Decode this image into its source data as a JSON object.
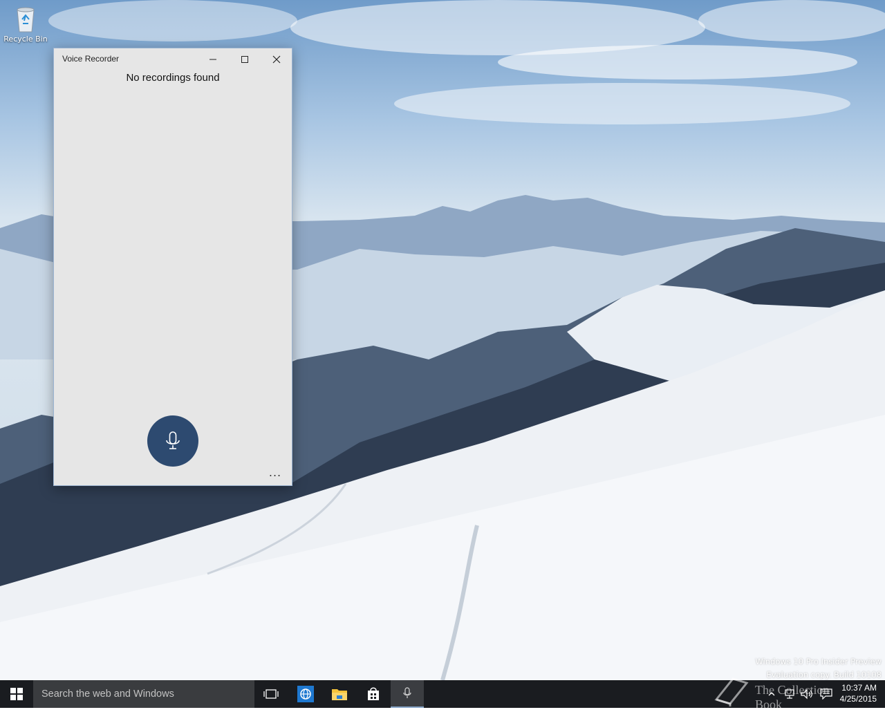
{
  "desktop": {
    "icons": [
      {
        "label": "Recycle Bin",
        "icon": "recycle-bin-icon"
      }
    ],
    "watermark": {
      "line1": "Windows 10 Pro Insider Preview",
      "line2": "Evaluation copy. Build 10108"
    }
  },
  "window": {
    "title": "Voice Recorder",
    "empty_message": "No recordings found",
    "record_icon": "microphone-icon",
    "more_label": "..."
  },
  "taskbar": {
    "search_placeholder": "Search the web and Windows",
    "items": [
      "task-view-icon",
      "edge-icon",
      "file-explorer-icon",
      "store-icon",
      "voice-recorder-icon"
    ],
    "tray_icons": [
      "chevron-up-icon",
      "network-icon",
      "volume-icon",
      "action-center-icon"
    ],
    "clock": {
      "time": "10:37 AM",
      "date": "4/25/2015"
    },
    "brand_text": "The Collection Book"
  }
}
